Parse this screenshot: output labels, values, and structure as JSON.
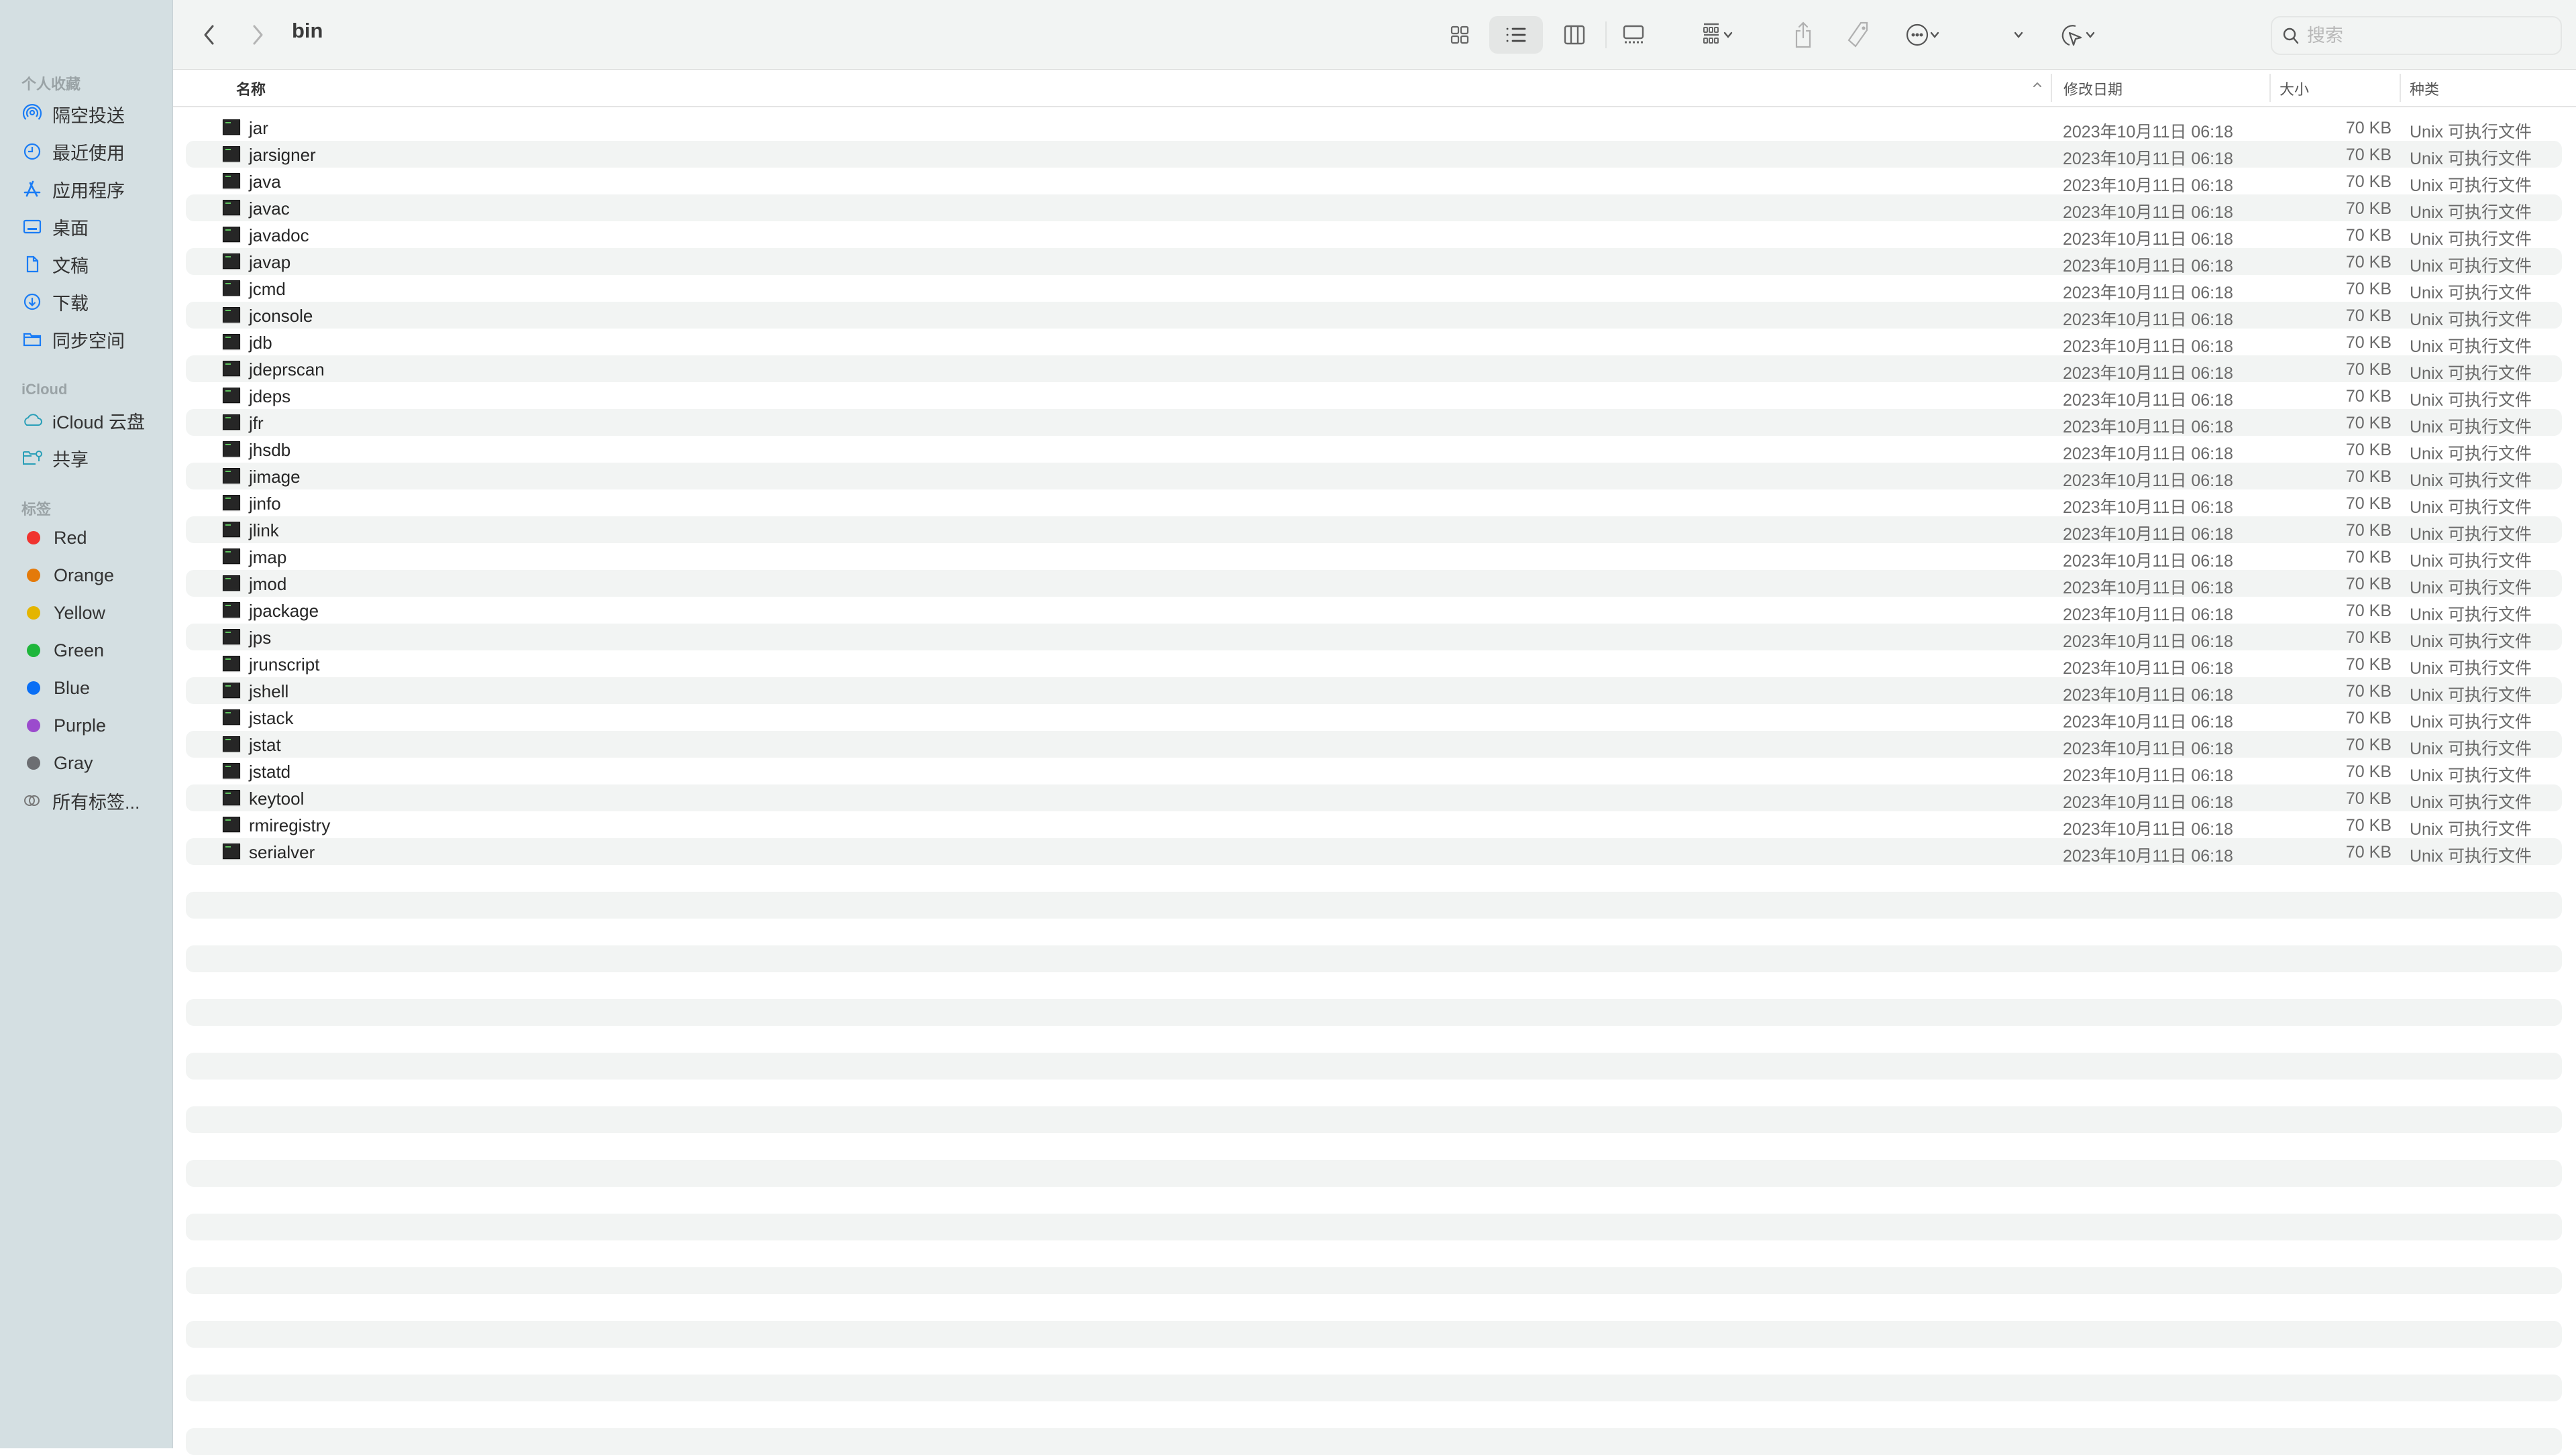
{
  "window": {
    "title": "bin"
  },
  "toolbar": {
    "back_label": "back",
    "forward_label": "forward",
    "search_placeholder": "搜索",
    "search_value": "",
    "view_mode": "list"
  },
  "sidebar": {
    "sections": [
      {
        "title": "个人收藏",
        "items": [
          {
            "label": "隔空投送",
            "icon": "airdrop-icon"
          },
          {
            "label": "最近使用",
            "icon": "clock-icon"
          },
          {
            "label": "应用程序",
            "icon": "applications-icon"
          },
          {
            "label": "桌面",
            "icon": "desktop-icon"
          },
          {
            "label": "文稿",
            "icon": "document-icon"
          },
          {
            "label": "下载",
            "icon": "download-icon"
          },
          {
            "label": "同步空间",
            "icon": "folder-icon"
          }
        ]
      },
      {
        "title": "iCloud",
        "items": [
          {
            "label": "iCloud 云盘",
            "icon": "cloud-icon"
          },
          {
            "label": "共享",
            "icon": "shared-folder-icon"
          }
        ]
      },
      {
        "title": "标签",
        "items": [
          {
            "label": "Red",
            "color": "#f0332f"
          },
          {
            "label": "Orange",
            "color": "#e47a0a"
          },
          {
            "label": "Yellow",
            "color": "#e4b500"
          },
          {
            "label": "Green",
            "color": "#1eb63b"
          },
          {
            "label": "Blue",
            "color": "#0a6ff5"
          },
          {
            "label": "Purple",
            "color": "#9b4bcd"
          },
          {
            "label": "Gray",
            "color": "#6c6e72"
          },
          {
            "label": "所有标签...",
            "icon": "all-tags-icon"
          }
        ]
      }
    ]
  },
  "columns": {
    "name": "名称",
    "date": "修改日期",
    "size": "大小",
    "kind": "种类"
  },
  "files": [
    {
      "name": "jar",
      "date": "2023年10月11日 06:18",
      "size": "70 KB",
      "kind": "Unix 可执行文件"
    },
    {
      "name": "jarsigner",
      "date": "2023年10月11日 06:18",
      "size": "70 KB",
      "kind": "Unix 可执行文件"
    },
    {
      "name": "java",
      "date": "2023年10月11日 06:18",
      "size": "70 KB",
      "kind": "Unix 可执行文件"
    },
    {
      "name": "javac",
      "date": "2023年10月11日 06:18",
      "size": "70 KB",
      "kind": "Unix 可执行文件"
    },
    {
      "name": "javadoc",
      "date": "2023年10月11日 06:18",
      "size": "70 KB",
      "kind": "Unix 可执行文件"
    },
    {
      "name": "javap",
      "date": "2023年10月11日 06:18",
      "size": "70 KB",
      "kind": "Unix 可执行文件"
    },
    {
      "name": "jcmd",
      "date": "2023年10月11日 06:18",
      "size": "70 KB",
      "kind": "Unix 可执行文件"
    },
    {
      "name": "jconsole",
      "date": "2023年10月11日 06:18",
      "size": "70 KB",
      "kind": "Unix 可执行文件"
    },
    {
      "name": "jdb",
      "date": "2023年10月11日 06:18",
      "size": "70 KB",
      "kind": "Unix 可执行文件"
    },
    {
      "name": "jdeprscan",
      "date": "2023年10月11日 06:18",
      "size": "70 KB",
      "kind": "Unix 可执行文件"
    },
    {
      "name": "jdeps",
      "date": "2023年10月11日 06:18",
      "size": "70 KB",
      "kind": "Unix 可执行文件"
    },
    {
      "name": "jfr",
      "date": "2023年10月11日 06:18",
      "size": "70 KB",
      "kind": "Unix 可执行文件"
    },
    {
      "name": "jhsdb",
      "date": "2023年10月11日 06:18",
      "size": "70 KB",
      "kind": "Unix 可执行文件"
    },
    {
      "name": "jimage",
      "date": "2023年10月11日 06:18",
      "size": "70 KB",
      "kind": "Unix 可执行文件"
    },
    {
      "name": "jinfo",
      "date": "2023年10月11日 06:18",
      "size": "70 KB",
      "kind": "Unix 可执行文件"
    },
    {
      "name": "jlink",
      "date": "2023年10月11日 06:18",
      "size": "70 KB",
      "kind": "Unix 可执行文件"
    },
    {
      "name": "jmap",
      "date": "2023年10月11日 06:18",
      "size": "70 KB",
      "kind": "Unix 可执行文件"
    },
    {
      "name": "jmod",
      "date": "2023年10月11日 06:18",
      "size": "70 KB",
      "kind": "Unix 可执行文件"
    },
    {
      "name": "jpackage",
      "date": "2023年10月11日 06:18",
      "size": "70 KB",
      "kind": "Unix 可执行文件"
    },
    {
      "name": "jps",
      "date": "2023年10月11日 06:18",
      "size": "70 KB",
      "kind": "Unix 可执行文件"
    },
    {
      "name": "jrunscript",
      "date": "2023年10月11日 06:18",
      "size": "70 KB",
      "kind": "Unix 可执行文件"
    },
    {
      "name": "jshell",
      "date": "2023年10月11日 06:18",
      "size": "70 KB",
      "kind": "Unix 可执行文件"
    },
    {
      "name": "jstack",
      "date": "2023年10月11日 06:18",
      "size": "70 KB",
      "kind": "Unix 可执行文件"
    },
    {
      "name": "jstat",
      "date": "2023年10月11日 06:18",
      "size": "70 KB",
      "kind": "Unix 可执行文件"
    },
    {
      "name": "jstatd",
      "date": "2023年10月11日 06:18",
      "size": "70 KB",
      "kind": "Unix 可执行文件"
    },
    {
      "name": "keytool",
      "date": "2023年10月11日 06:18",
      "size": "70 KB",
      "kind": "Unix 可执行文件"
    },
    {
      "name": "rmiregistry",
      "date": "2023年10月11日 06:18",
      "size": "70 KB",
      "kind": "Unix 可执行文件"
    },
    {
      "name": "serialver",
      "date": "2023年10月11日 06:18",
      "size": "70 KB",
      "kind": "Unix 可执行文件"
    }
  ]
}
